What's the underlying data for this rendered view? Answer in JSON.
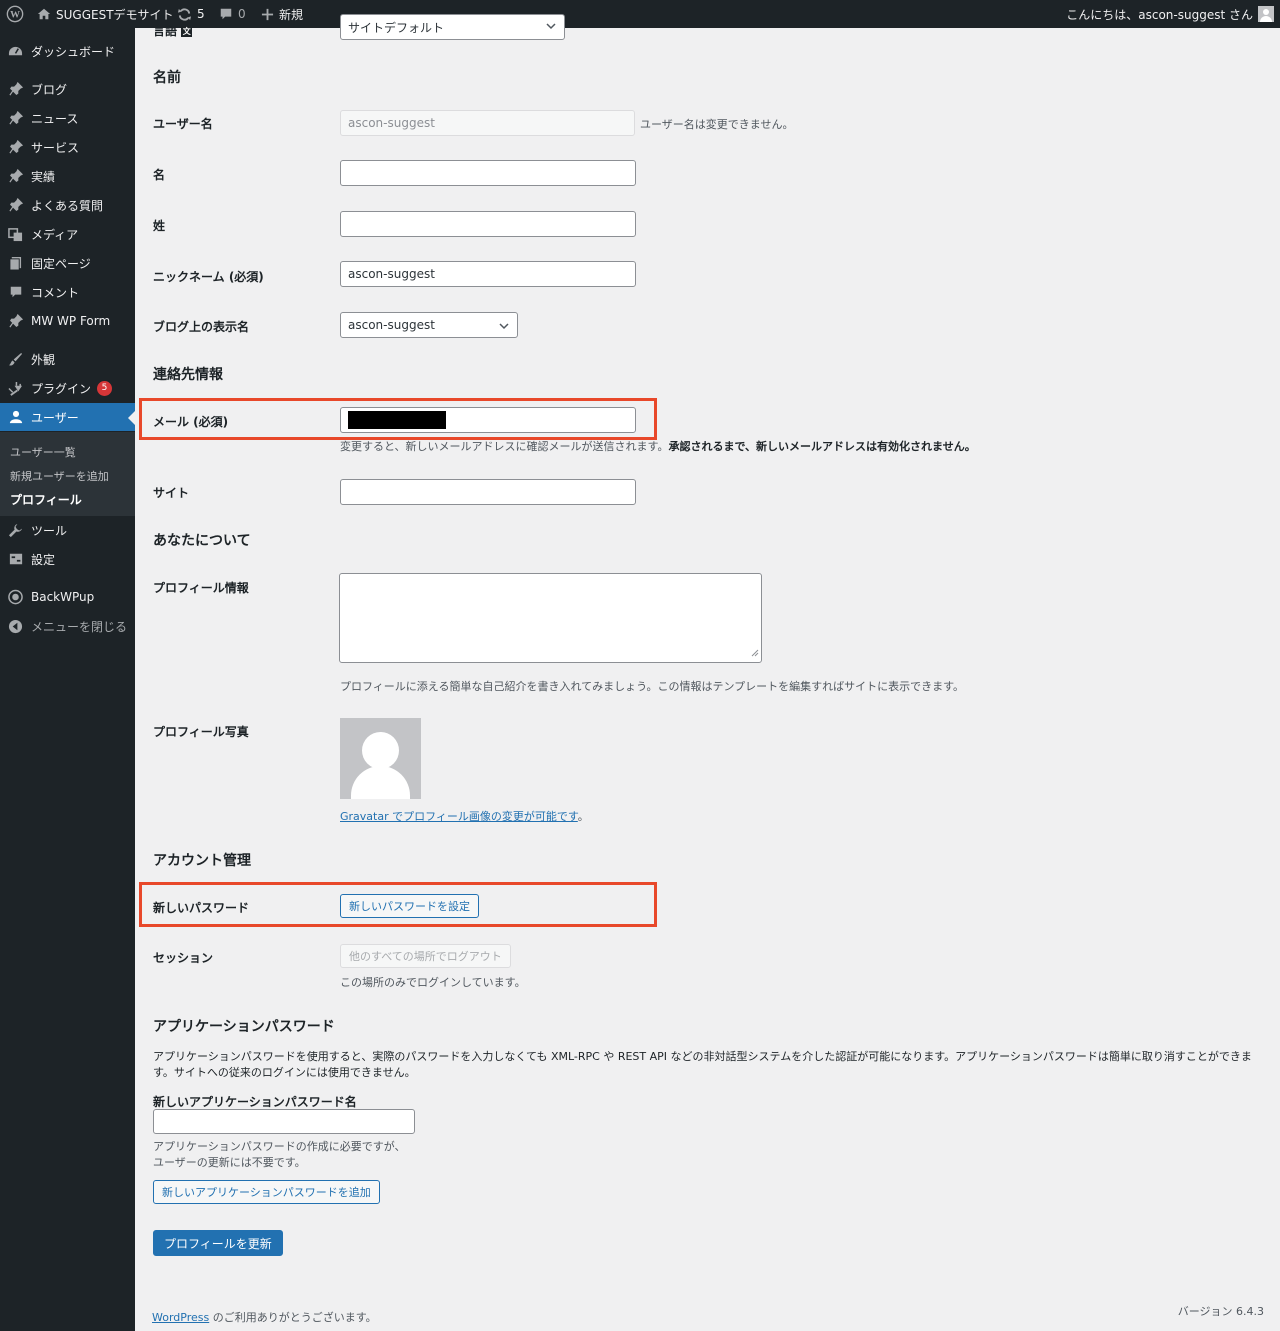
{
  "admin_bar": {
    "site_name": "SUGGESTデモサイト",
    "updates_count": "5",
    "comments_count": "0",
    "new_label": "新規",
    "greeting": "こんにちは、ascon-suggest さん"
  },
  "sidebar": {
    "items": [
      {
        "label": "ダッシュボード",
        "icon": "dashboard-icon"
      },
      {
        "label": "ブログ",
        "icon": "pin-icon"
      },
      {
        "label": "ニュース",
        "icon": "pin-icon"
      },
      {
        "label": "サービス",
        "icon": "pin-icon"
      },
      {
        "label": "実績",
        "icon": "pin-icon"
      },
      {
        "label": "よくある質問",
        "icon": "pin-icon"
      },
      {
        "label": "メディア",
        "icon": "media-icon"
      },
      {
        "label": "固定ページ",
        "icon": "page-icon"
      },
      {
        "label": "コメント",
        "icon": "comment-icon"
      },
      {
        "label": "MW WP Form",
        "icon": "pin-icon"
      },
      {
        "label": "外観",
        "icon": "brush-icon"
      },
      {
        "label": "プラグイン",
        "icon": "plugin-icon",
        "badge": "5"
      },
      {
        "label": "ユーザー",
        "icon": "user-icon"
      },
      {
        "label": "ツール",
        "icon": "wrench-icon"
      },
      {
        "label": "設定",
        "icon": "settings-icon"
      },
      {
        "label": "BackWPup",
        "icon": "backwpup-icon"
      },
      {
        "label": "メニューを閉じる",
        "icon": "collapse-icon"
      }
    ],
    "submenu": [
      {
        "label": "ユーザー一覧"
      },
      {
        "label": "新規ユーザーを追加"
      },
      {
        "label": "プロフィール"
      }
    ]
  },
  "form": {
    "language_label": "言語",
    "language_value": "サイトデフォルト",
    "name_heading": "名前",
    "username_label": "ユーザー名",
    "username_value": "ascon-suggest",
    "username_note": "ユーザー名は変更できません。",
    "first_name_label": "名",
    "last_name_label": "姓",
    "nickname_label": "ニックネーム (必須)",
    "nickname_value": "ascon-suggest",
    "display_name_label": "ブログ上の表示名",
    "display_name_value": "ascon-suggest",
    "contact_heading": "連絡先情報",
    "email_label": "メール (必須)",
    "email_note_plain": "変更すると、新しいメールアドレスに確認メールが送信されます。",
    "email_note_bold": "承認されるまで、新しいメールアドレスは有効化されません。",
    "site_label": "サイト",
    "about_heading": "あなたについて",
    "bio_label": "プロフィール情報",
    "bio_note": "プロフィールに添える簡単な自己紹介を書き入れてみましょう。この情報はテンプレートを編集すればサイトに表示できます。",
    "photo_label": "プロフィール写真",
    "gravatar_link": "Gravatar でプロフィール画像の変更が可能です",
    "gravatar_suffix": "。",
    "account_heading": "アカウント管理",
    "new_password_label": "新しいパスワード",
    "new_password_button": "新しいパスワードを設定",
    "session_label": "セッション",
    "logout_button": "他のすべての場所でログアウト",
    "session_note": "この場所のみでログインしています。",
    "app_pw_heading": "アプリケーションパスワード",
    "app_pw_desc_line1": "アプリケーションパスワードを使用すると、実際のパスワードを入力しなくても XML-RPC や REST API などの非対話型システムを介した認証が可能になります。アプリケーションパスワードは簡単に取り消すことができま",
    "app_pw_desc_line2": "す。サイトへの従来のログインには使用できません。",
    "app_pw_name_label": "新しいアプリケーションパスワード名",
    "app_pw_note_line1": "アプリケーションパスワードの作成に必要ですが、",
    "app_pw_note_line2": "ユーザーの更新には不要です。",
    "app_pw_add_button": "新しいアプリケーションパスワードを追加",
    "update_button": "プロフィールを更新"
  },
  "footer": {
    "wordpress_link": "WordPress",
    "thanks": " のご利用ありがとうございます。",
    "version": "バージョン 6.4.3"
  },
  "colors": {
    "highlight": "#e8482a",
    "accent": "#2271b1"
  }
}
